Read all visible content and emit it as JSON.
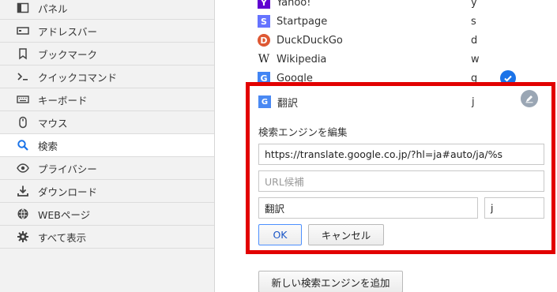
{
  "sidebar": {
    "items": [
      {
        "label": "パネル",
        "icon": "panel-icon"
      },
      {
        "label": "アドレスバー",
        "icon": "address-bar-icon"
      },
      {
        "label": "ブックマーク",
        "icon": "bookmark-icon"
      },
      {
        "label": "クイックコマンド",
        "icon": "quick-command-icon"
      },
      {
        "label": "キーボード",
        "icon": "keyboard-icon"
      },
      {
        "label": "マウス",
        "icon": "mouse-icon"
      },
      {
        "label": "検索",
        "icon": "search-icon",
        "active": true
      },
      {
        "label": "プライバシー",
        "icon": "eye-icon"
      },
      {
        "label": "ダウンロード",
        "icon": "download-icon"
      },
      {
        "label": "WEBページ",
        "icon": "globe-icon"
      },
      {
        "label": "すべて表示",
        "icon": "gear-icon"
      }
    ]
  },
  "engines": [
    {
      "name": "Yahoo!",
      "keyword": "y",
      "icon": "yahoo-icon"
    },
    {
      "name": "Startpage",
      "keyword": "s",
      "icon": "startpage-icon"
    },
    {
      "name": "DuckDuckGo",
      "keyword": "d",
      "icon": "duckduckgo-icon"
    },
    {
      "name": "Wikipedia",
      "keyword": "w",
      "icon": "wikipedia-icon"
    },
    {
      "name": "Google",
      "keyword": "g",
      "icon": "google-icon",
      "default": true
    }
  ],
  "editing": {
    "name": "翻訳",
    "keyword": "j",
    "section_title": "検索エンジンを編集",
    "url_value": "https://translate.google.co.jp/?hl=ja#auto/ja/%s",
    "suggest_placeholder": "URL候補",
    "name_value": "翻訳",
    "keyword_value": "j",
    "ok_label": "OK",
    "cancel_label": "キャンセル"
  },
  "add_button_label": "新しい検索エンジンを追加",
  "colors": {
    "highlight_border": "#e20000",
    "accent": "#1a73e8"
  }
}
